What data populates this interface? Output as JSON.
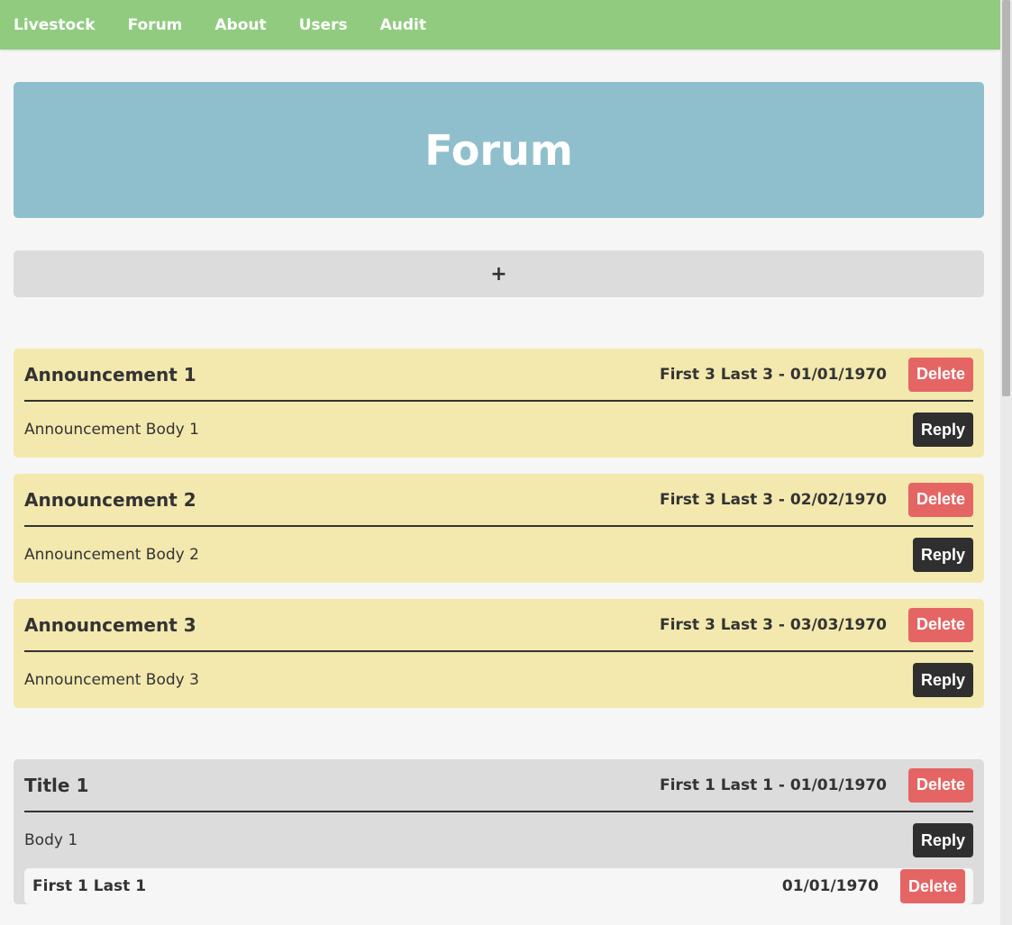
{
  "nav": {
    "items": [
      {
        "label": "Livestock"
      },
      {
        "label": "Forum"
      },
      {
        "label": "About"
      },
      {
        "label": "Users"
      },
      {
        "label": "Audit"
      }
    ]
  },
  "page_title": "Forum",
  "add_button_label": "+",
  "announcements": [
    {
      "title": "Announcement 1",
      "meta": "First 3 Last 3 - 01/01/1970",
      "body": "Announcement Body 1",
      "delete_label": "Delete",
      "reply_label": "Reply"
    },
    {
      "title": "Announcement 2",
      "meta": "First 3 Last 3 - 02/02/1970",
      "body": "Announcement Body 2",
      "delete_label": "Delete",
      "reply_label": "Reply"
    },
    {
      "title": "Announcement 3",
      "meta": "First 3 Last 3 - 03/03/1970",
      "body": "Announcement Body 3",
      "delete_label": "Delete",
      "reply_label": "Reply"
    }
  ],
  "posts": [
    {
      "title": "Title 1",
      "meta": "First 1 Last 1 - 01/01/1970",
      "body": "Body 1",
      "delete_label": "Delete",
      "reply_label": "Reply",
      "reply": {
        "author": "First 1 Last 1",
        "meta": "01/01/1970",
        "delete_label": "Delete"
      }
    }
  ],
  "colors": {
    "navbar": "#90cb7f",
    "jumbotron": "#8fbfcc",
    "announcement": "#f3e8ae",
    "post": "#dcdcdc",
    "delete": "#e56565",
    "reply": "#2f2f2f"
  }
}
